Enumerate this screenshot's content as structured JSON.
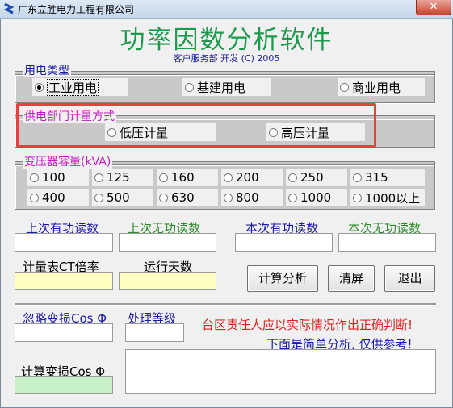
{
  "window": {
    "title": "广东立胜电力工程有限公司",
    "close_icon": "✕"
  },
  "header": {
    "app_title": "功率因数分析软件",
    "subtitle": "客户服务部  开发  (C) 2005"
  },
  "usage_type": {
    "label": "用电类型",
    "options": [
      "工业用电",
      "基建用电",
      "商业用电"
    ],
    "selected": "工业用电"
  },
  "metering": {
    "label": "供电部门计量方式",
    "options": [
      "低压计量",
      "高压计量"
    ]
  },
  "transformer": {
    "label": "变压器容量(kVA)",
    "options": [
      "100",
      "125",
      "160",
      "200",
      "250",
      "315",
      "400",
      "500",
      "630",
      "800",
      "1000",
      "1000以上"
    ]
  },
  "readings": {
    "prev_active": "上次有功读数",
    "prev_reactive": "上次无功读数",
    "curr_active": "本次有功读数",
    "curr_reactive": "本次无功读数"
  },
  "params": {
    "ct_ratio": "计量表CT倍率",
    "run_days": "运行天数"
  },
  "buttons": {
    "calculate": "计算分析",
    "clear": "清屏",
    "exit": "退出"
  },
  "results": {
    "ignore_loss": "忽略变损Cos Φ",
    "grade": "处理等级",
    "calc_loss": "计算变损Cos Φ"
  },
  "notice": {
    "line1": "台区责任人应以实际情况作出正确判断!",
    "line2": "下面是简单分析, 仅供参考!"
  },
  "colors": {
    "title_green": "#1e9a4e",
    "label_blue": "#1a1aa8",
    "label_green": "#2e8b2e",
    "label_magenta": "#c020c0",
    "notice_red": "#e02020",
    "highlight_red": "#e8403e",
    "input_yellow": "#ffffc0",
    "input_green": "#c8f0c8"
  }
}
